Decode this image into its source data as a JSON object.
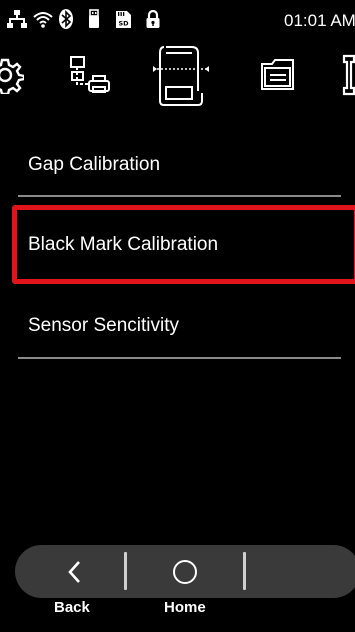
{
  "status_bar": {
    "time": "01:01 AM",
    "icons": [
      "network-icon",
      "wifi-icon",
      "bluetooth-icon",
      "usb-icon",
      "sd-card-icon",
      "lock-icon"
    ]
  },
  "toolbar": {
    "icons": [
      "settings-gear-icon",
      "printer-network-icon",
      "media-sensor-icon",
      "file-manager-icon",
      "tools-icon"
    ],
    "active": "media-sensor-icon"
  },
  "menu": {
    "items": [
      {
        "label": "Gap Calibration"
      },
      {
        "label": "Black Mark Calibration"
      },
      {
        "label": "Sensor Sencitivity"
      }
    ],
    "selected_index": 1,
    "highlight_color": "#e1141c"
  },
  "nav": {
    "back_label": "Back",
    "home_label": "Home"
  }
}
